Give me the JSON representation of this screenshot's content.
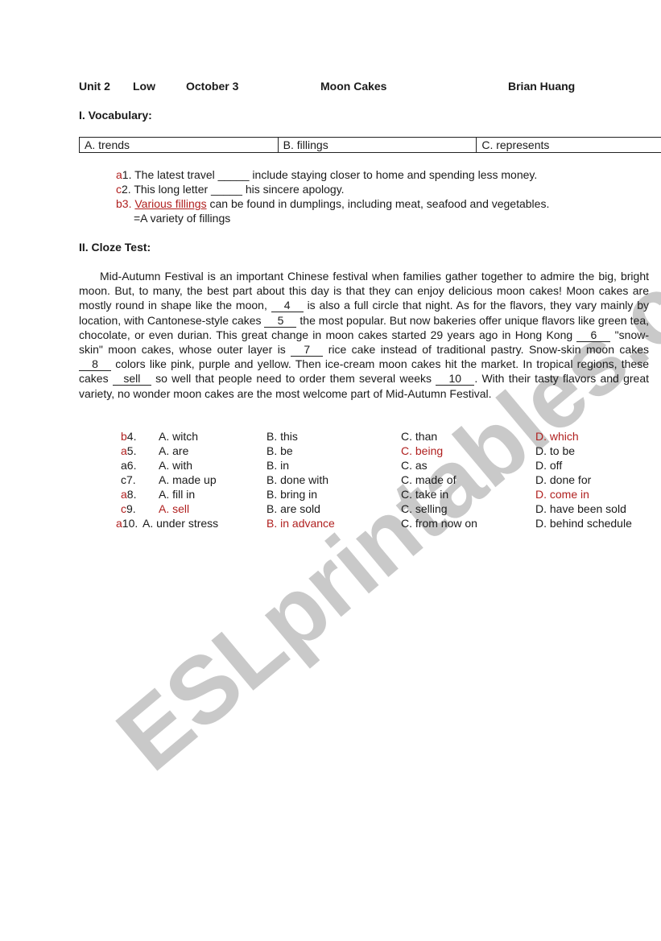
{
  "watermark": "ESLprintables.com",
  "header": {
    "unit": "Unit 2",
    "level": "Low",
    "date": "October 3",
    "title": "Moon Cakes",
    "author": "Brian Huang"
  },
  "vocabulary": {
    "heading": "I. Vocabulary:",
    "word_bank": [
      "A. trends",
      "B. fillings",
      "C. represents"
    ],
    "questions": [
      {
        "answer": "a",
        "number": "1",
        "text": ". The latest travel _____ include staying closer to home and spending less money."
      },
      {
        "answer": "c",
        "number": "2",
        "text": ". This long letter _____ his sincere apology."
      },
      {
        "answer": "b",
        "number": "3",
        "prefix": ". ",
        "underlined": "Various fillings",
        "text": " can be found in dumplings, including meat, seafood and vegetables.",
        "note": "=A variety of fillings"
      }
    ]
  },
  "cloze": {
    "heading": "II. Cloze Test:",
    "passage": {
      "p1": "Mid-Autumn Festival is an important Chinese festival when families gather together to admire the big, bright moon. But, to many, the best part about this day is that they can enjoy delicious moon cakes! Moon cakes are mostly round in shape like the moon, ",
      "blank4": "4",
      "p2": " is also a full circle that night. As for the flavors, they vary mainly by location, with Cantonese-style cakes ",
      "blank5": "5",
      "p3": " the most popular. But now bakeries offer unique flavors like green tea, chocolate, or even durian. This great change in moon cakes started 29 years ago in Hong Kong ",
      "blank6": "6",
      "p4": " \"snow-skin\" moon cakes, whose outer layer is ",
      "blank7": "7",
      "p5": " rice cake instead of traditional pastry. Snow-skin moon cakes ",
      "blank8": "8",
      "p6": " colors like pink, purple and yellow. Then ice-cream moon cakes hit the market. In tropical regions, these cakes ",
      "blank9": "sell",
      "p7": " so well that people need to order them several weeks ",
      "blank10": "10",
      "p8": ". With their tasty flavors and great variety, no wonder moon cakes are the most welcome part of Mid-Autumn Festival."
    },
    "options": [
      {
        "answer": "b",
        "number": "4.",
        "A": "A. witch",
        "B": "B. this",
        "C": "C. than",
        "D": "D. which",
        "correct": "D"
      },
      {
        "answer": "a",
        "number": "5.",
        "A": "A. are",
        "B": "B. be",
        "C": "C. being",
        "D": "D. to be",
        "correct": "C"
      },
      {
        "answer": "a",
        "number": "6.",
        "A": "A. with",
        "B": "B. in",
        "C": "C. as",
        "D": "D. off",
        "correct": ""
      },
      {
        "answer": "c",
        "number": "7.",
        "A": "A. made up",
        "B": "B. done with",
        "C": "C. made of",
        "D": "D. done for",
        "correct": ""
      },
      {
        "answer": "a",
        "number": "8.",
        "A": "A. fill in",
        "B": "B. bring in",
        "C": "C. take in",
        "D": "D. come in",
        "correct": "D"
      },
      {
        "answer": "c",
        "number": "9.",
        "A": "A. sell",
        "B": "B. are sold",
        "C": "C. selling",
        "D": "D. have been sold",
        "correct": "A"
      },
      {
        "answer": "a",
        "number": "10.",
        "A": "A. under stress",
        "B": "B. in advance",
        "C": "C. from now on",
        "D": "D. behind schedule",
        "correct": "B"
      }
    ]
  },
  "colors": {
    "answer_red": "#b0201f",
    "text": "#1a1a1a",
    "watermark": "#c9c9c9"
  }
}
